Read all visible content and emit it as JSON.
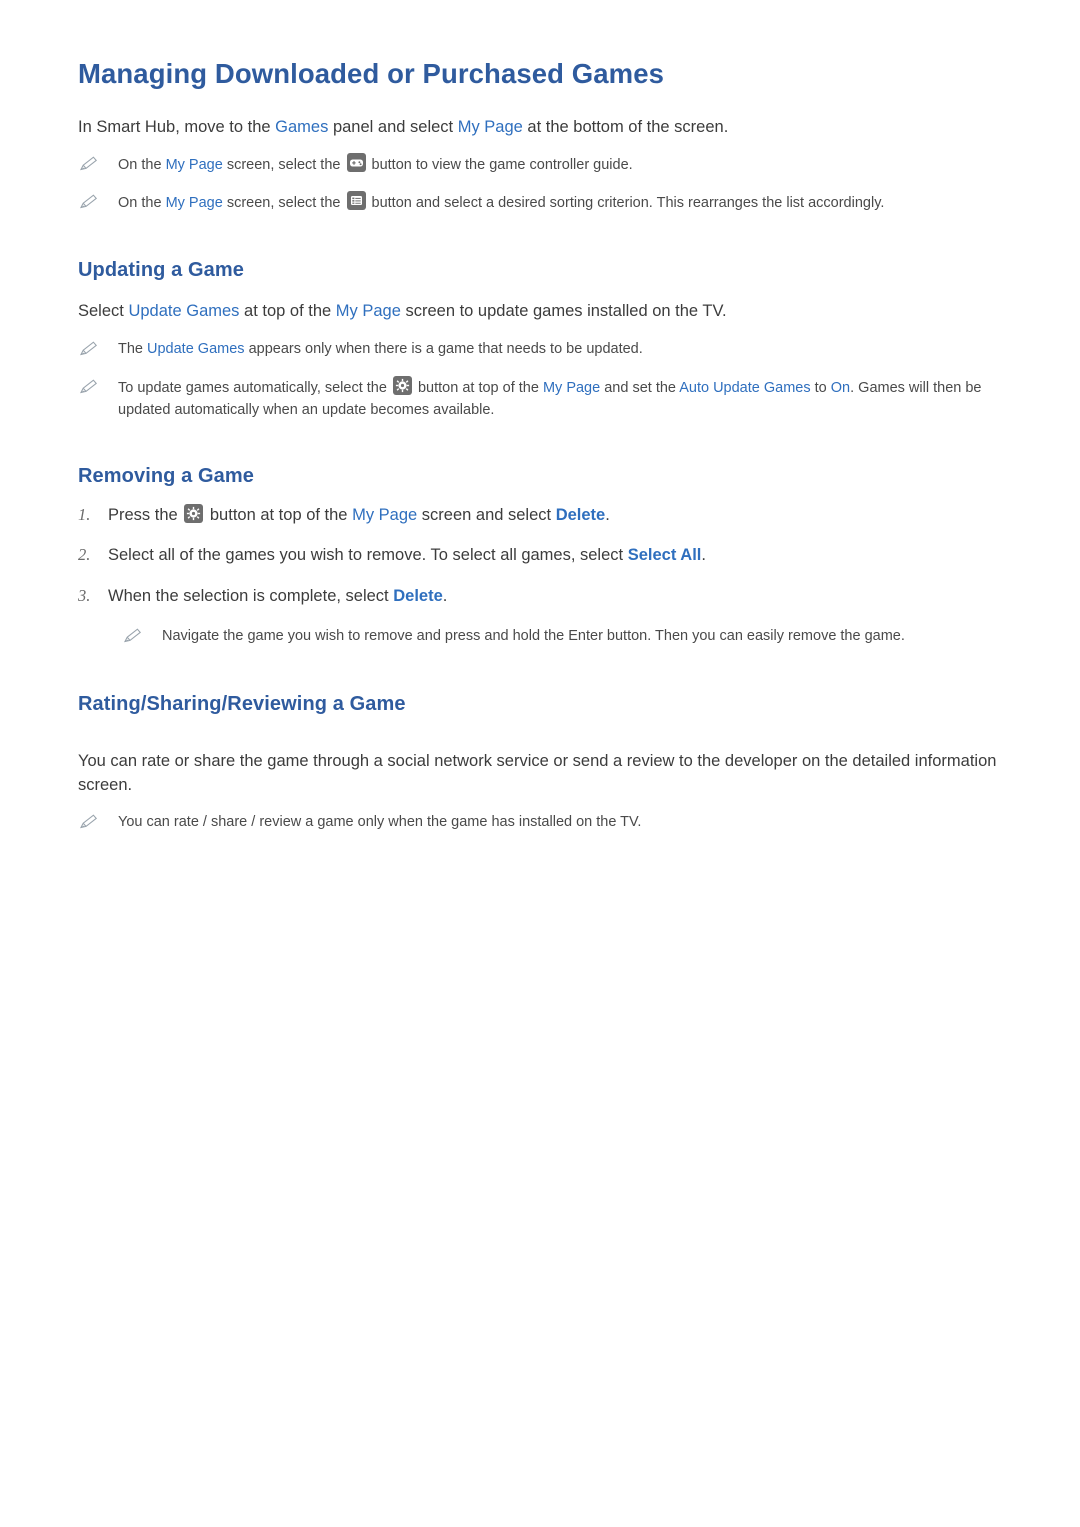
{
  "document": {
    "title": "Managing Downloaded or Purchased Games",
    "intro": {
      "part1": "In Smart Hub, move to the ",
      "games": "Games",
      "part2": " panel and select ",
      "my_page": "My Page",
      "part3": " at the bottom of the screen."
    },
    "intro_notes": [
      {
        "part1": "On the ",
        "my_page": "My Page",
        "part2": " screen, select the ",
        "icon": "gamepad-icon",
        "part3": " button to view the game controller guide."
      },
      {
        "part1": "On the ",
        "my_page": "My Page",
        "part2": " screen, select the ",
        "icon": "list-icon",
        "part3": " button and select a desired sorting criterion. This rearranges the list accordingly."
      }
    ],
    "sections": [
      {
        "heading": "Updating a Game",
        "lead": {
          "part1": "Select ",
          "update_games": "Update Games",
          "part2": " at top of the ",
          "my_page": "My Page",
          "part3": " screen to update games installed on the TV."
        },
        "notes": [
          {
            "part1": "The ",
            "update_games": "Update Games",
            "part2": " appears only when there is a game that needs to be updated."
          },
          {
            "part1": "To update games automatically, select the ",
            "icon": "gear-icon",
            "part2": " button at top of the ",
            "my_page": "My Page",
            "part3": " and set the ",
            "auto_update": "Auto Update Games",
            "part4": " to ",
            "on": "On",
            "part5": ". Games will then be updated automatically when an update becomes available."
          }
        ]
      },
      {
        "heading": "Removing a Game",
        "steps": [
          {
            "num": "1.",
            "part1": "Press the ",
            "icon": "gear-icon",
            "part2": " button at top of the ",
            "my_page": "My Page",
            "part3": " screen and select ",
            "delete": "Delete",
            "part4": "."
          },
          {
            "num": "2.",
            "part1": "Select all of the games you wish to remove. To select all games, select ",
            "select_all": "Select All",
            "part2": "."
          },
          {
            "num": "3.",
            "part1": "When the selection is complete, select ",
            "delete": "Delete",
            "part2": "."
          }
        ],
        "notes": [
          {
            "text": "Navigate the game you wish to remove and press and hold the Enter button. Then you can easily remove the game."
          }
        ]
      },
      {
        "heading": "Rating/Sharing/Reviewing a Game",
        "lead_plain": "You can rate or share the game through a social network service or send a review to the developer on the detailed information screen.",
        "notes": [
          {
            "text": "You can rate / share / review a game only when the game has installed on the TV."
          }
        ]
      }
    ],
    "colors": {
      "heading": "#2f5b9e",
      "link": "#2f6fbe",
      "body": "#3c3c3c",
      "note": "#4a4a4a",
      "icon_bg": "#6e6e6e"
    }
  }
}
